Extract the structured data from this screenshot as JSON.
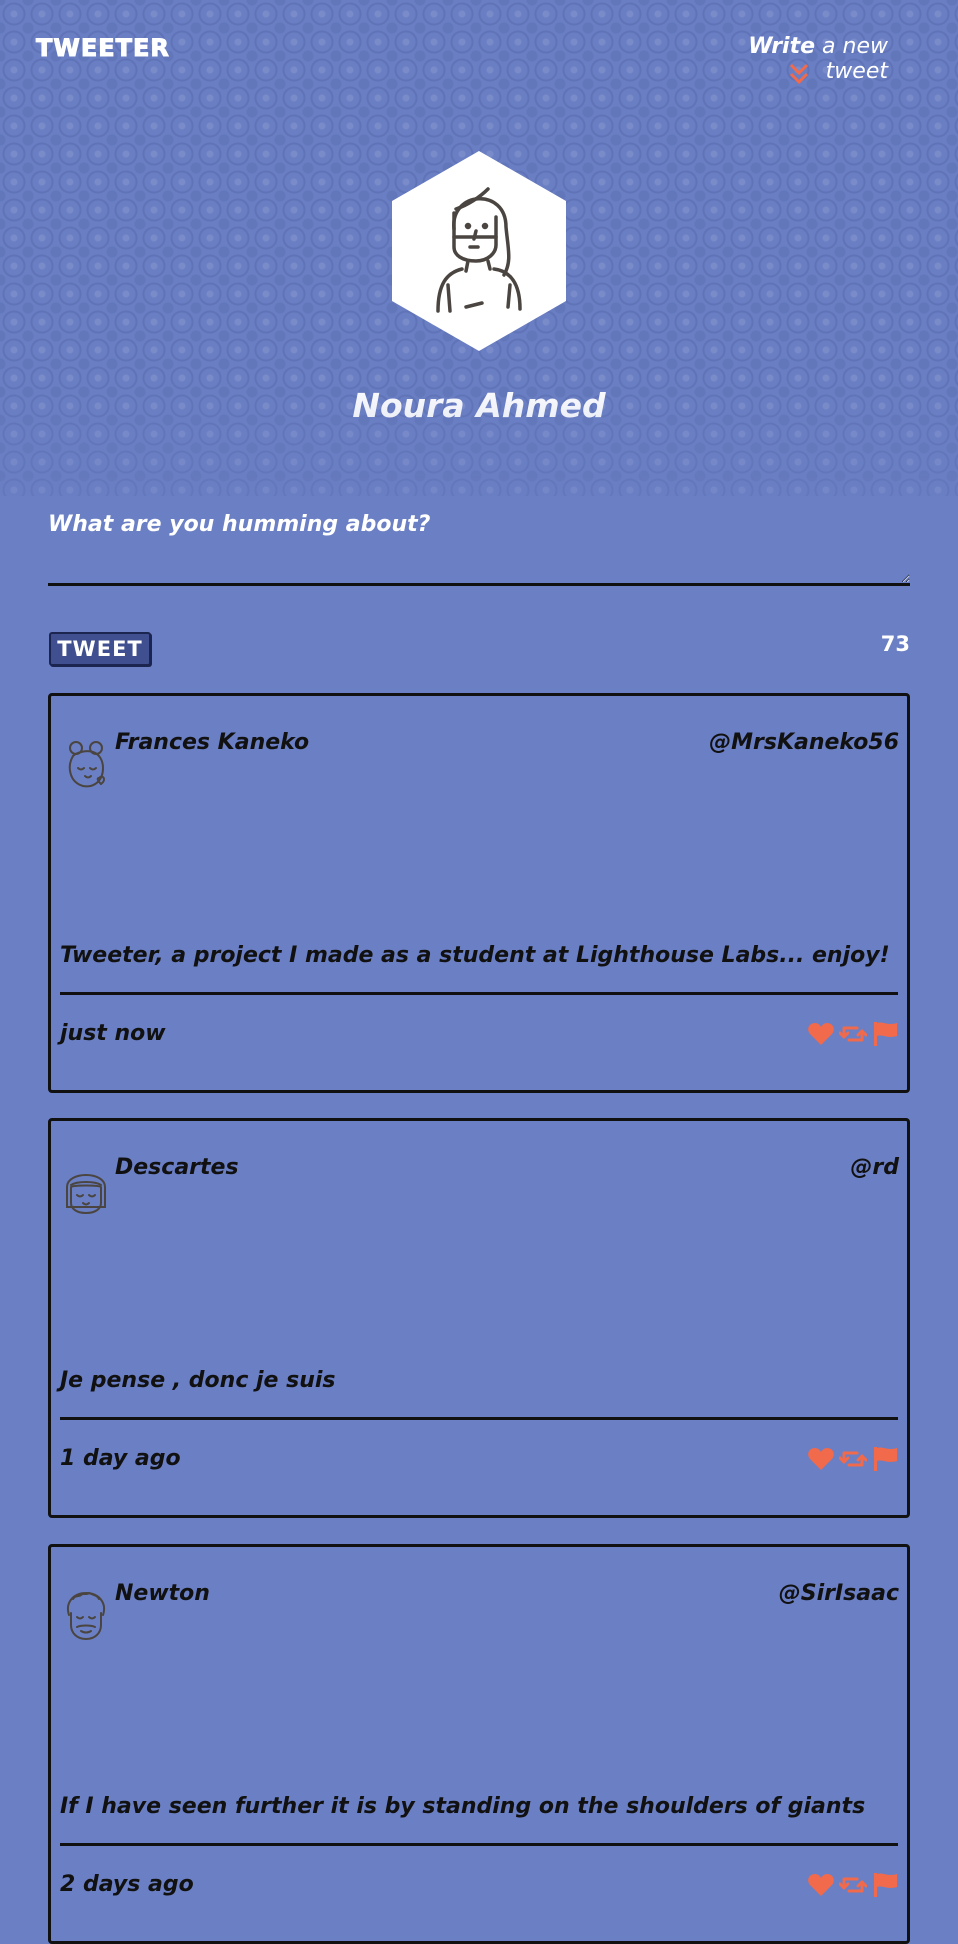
{
  "nav": {
    "logo": "TWEETER",
    "compose_link_bold": "Write",
    "compose_link_rest": " a new tweet",
    "chevron_icon": "double-chevron-down-icon",
    "accent_color": "#f06a4b"
  },
  "profile": {
    "name": "Noura Ahmed",
    "avatar_icon": "profile-avatar-icon"
  },
  "compose": {
    "placeholder": "What are you humming about?",
    "button_label": "TWEET",
    "counter": "73"
  },
  "tweets": [
    {
      "name": "Frances Kaneko",
      "handle": "@MrsKaneko56",
      "text": "Tweeter, a project I made as a student at Lighthouse Labs... enjoy!",
      "time": "just now",
      "avatar_icon": "user-avatar-icon"
    },
    {
      "name": "Descartes",
      "handle": "@rd",
      "text": "Je pense , donc je suis",
      "time": "1 day ago",
      "avatar_icon": "user-avatar-icon"
    },
    {
      "name": "Newton",
      "handle": "@SirIsaac",
      "text": "If I have seen further it is by standing on the shoulders of giants",
      "time": "2 days ago",
      "avatar_icon": "user-avatar-icon"
    }
  ],
  "colors": {
    "background": "#6b7fc4",
    "accent": "#f06a4b",
    "text": "#111111",
    "button_bg": "#3f4f8f"
  }
}
